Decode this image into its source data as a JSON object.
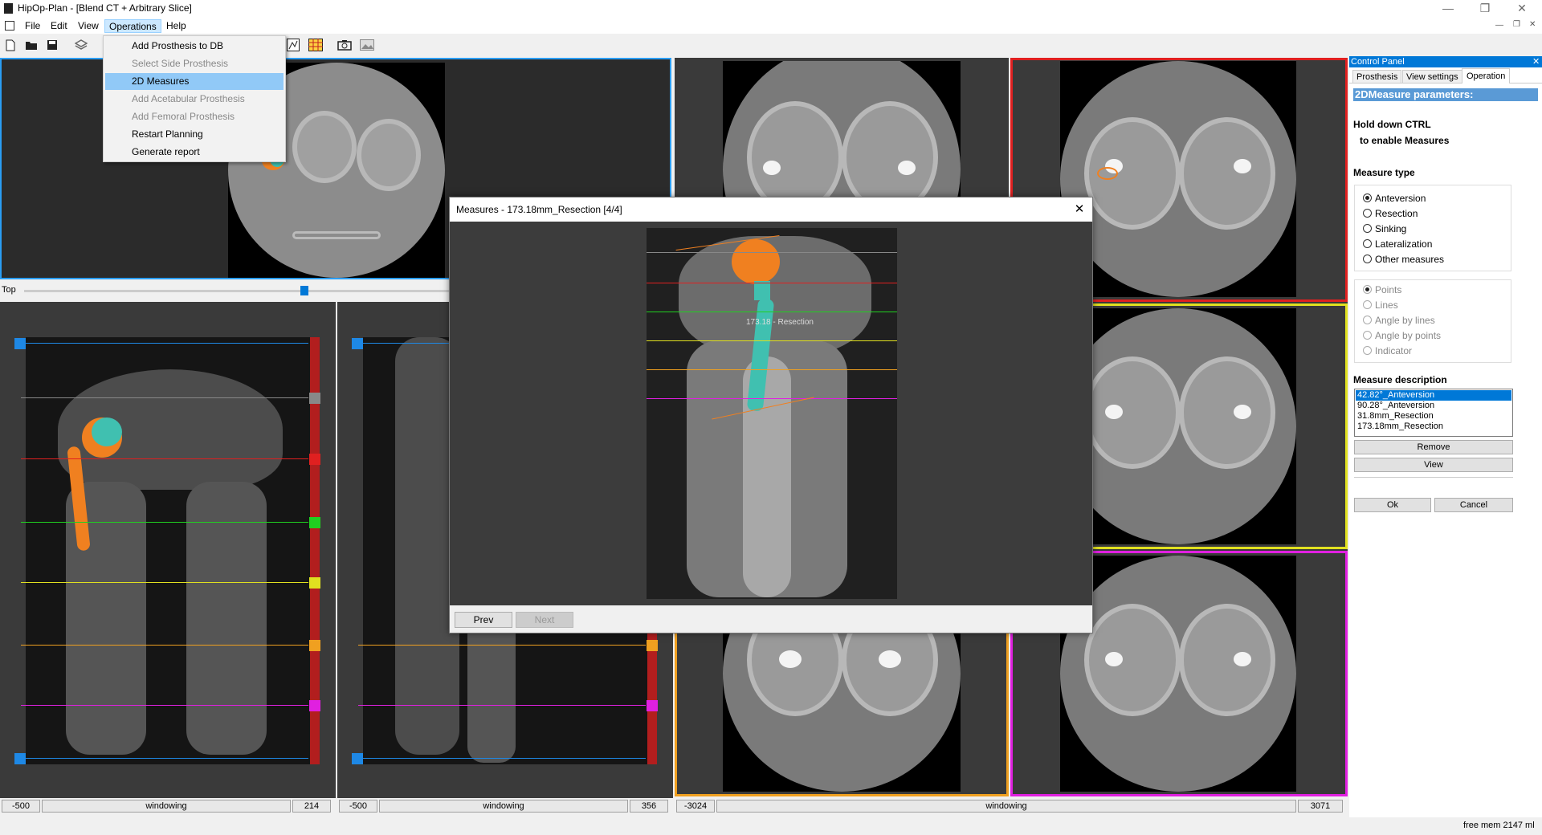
{
  "window": {
    "title": "HipOp-Plan - [Blend CT + Arbitrary Slice]",
    "controls": [
      "minimize-icon",
      "restore-icon",
      "close-icon"
    ]
  },
  "menubar": {
    "items": [
      "File",
      "Edit",
      "View",
      "Operations",
      "Help"
    ],
    "active": "Operations"
  },
  "operations_menu": {
    "items": [
      {
        "label": "Add Prosthesis to DB",
        "enabled": true
      },
      {
        "label": "Select Side Prosthesis",
        "enabled": false
      },
      {
        "label": "2D Measures",
        "enabled": true,
        "highlighted": true
      },
      {
        "label": "Add Acetabular Prosthesis",
        "enabled": false
      },
      {
        "label": "Add Femoral Prosthesis",
        "enabled": false
      },
      {
        "label": "Restart Planning",
        "enabled": true
      },
      {
        "label": "Generate report",
        "enabled": true
      }
    ]
  },
  "toolbar": {
    "icons": [
      "new-file-icon",
      "open-folder-icon",
      "save-icon",
      "layers-icon",
      "chart-icon",
      "table-icon",
      "camera-icon",
      "image-icon"
    ]
  },
  "top_view": {
    "slider_label": "Top",
    "slider_value_percent": 50
  },
  "xray_left": {
    "status_min": "-500",
    "status_label": "windowing",
    "status_max": "214"
  },
  "xray_right": {
    "status_min": "-500",
    "status_label": "windowing",
    "status_max": "356"
  },
  "ct_views": {
    "status_min": "-3024",
    "status_label": "windowing",
    "status_max": "3071"
  },
  "dialog": {
    "title": "Measures - 173.18mm_Resection [4/4]",
    "image_annotation": "173.18 - Resection",
    "prev_label": "Prev",
    "next_label": "Next",
    "next_enabled": false
  },
  "control_panel": {
    "title": "Control Panel",
    "tabs": [
      "Prosthesis",
      "View settings",
      "Operation"
    ],
    "active_tab": "Operation",
    "section_header": "2DMeasure parameters:",
    "hint_line1": "Hold down CTRL",
    "hint_line2": "to enable Measures",
    "measure_type_label": "Measure type",
    "measure_types": [
      "Anteversion",
      "Resection",
      "Sinking",
      "Lateralization",
      "Other measures"
    ],
    "measure_type_selected": "Anteversion",
    "shape_types": [
      "Points",
      "Lines",
      "Angle by lines",
      "Angle by points",
      "Indicator"
    ],
    "shape_type_selected": "Points",
    "description_label": "Measure description",
    "descriptions": [
      "42.82°_Anteversion",
      "90.28°_Anteversion",
      "31.8mm_Resection",
      "173.18mm_Resection"
    ],
    "description_selected": "42.82°_Anteversion",
    "remove_label": "Remove",
    "view_label": "View",
    "ok_label": "Ok",
    "cancel_label": "Cancel"
  },
  "statusbar": {
    "free_mem": "free mem 2147 ml"
  },
  "colors": {
    "measure_lines": [
      "#e02020",
      "#20d020",
      "#e0e020",
      "#f0a020",
      "#e020e0"
    ],
    "prosthesis_head": "#f08020",
    "prosthesis_stem": "#40c0b0",
    "selection_blue": "#0078d7"
  }
}
